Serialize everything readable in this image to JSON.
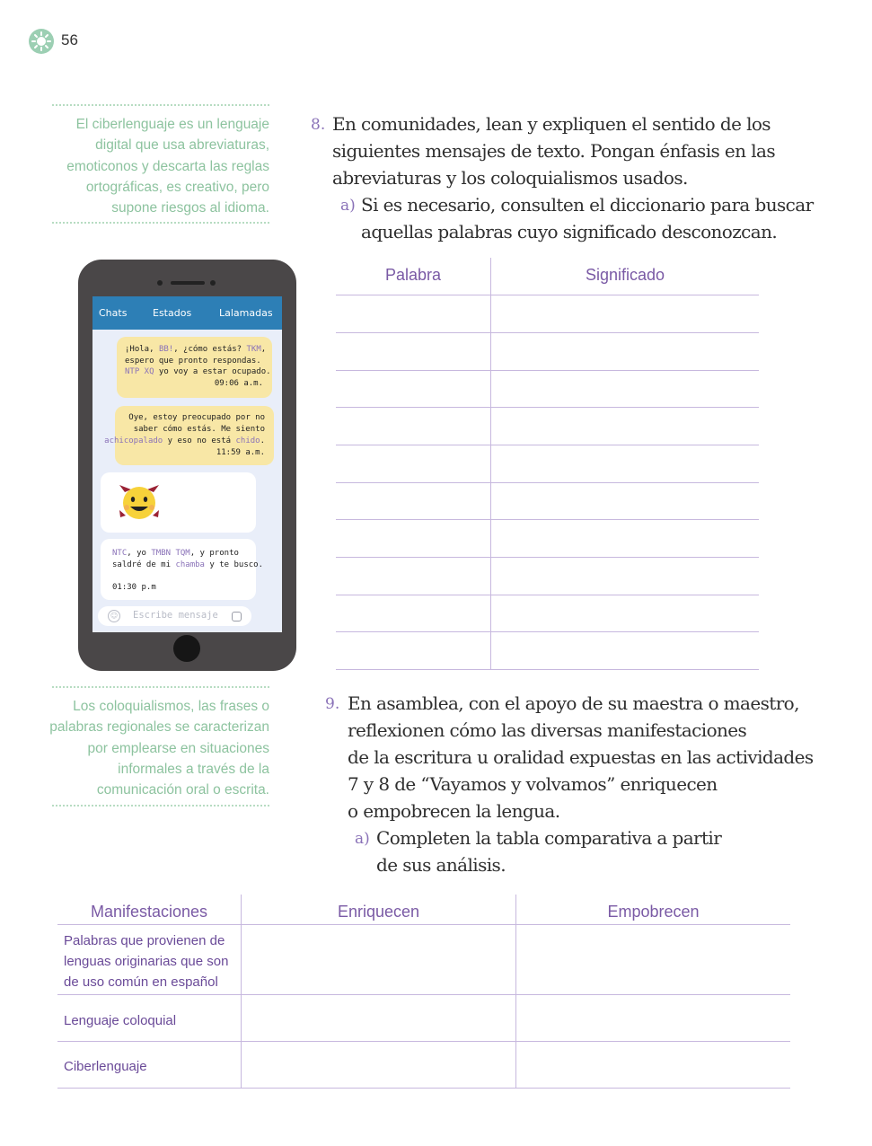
{
  "header": {
    "page_number": "56"
  },
  "notes": {
    "ciberlenguaje": [
      "El ciberlenguaje es un lenguaje",
      "digital que usa abreviaturas,",
      "emoticonos y descarta las reglas",
      "ortográficas, es creativo, pero",
      "supone riesgos al idioma."
    ],
    "coloquialismos": [
      "Los coloquialismos, las frases o",
      "palabras regionales se caracterizan",
      "por emplearse en situaciones",
      "informales a través de la",
      "comunicación oral o escrita."
    ]
  },
  "phone": {
    "tabs": [
      "Chats",
      "Estados",
      "Lalamadas"
    ],
    "msg1": {
      "l1_a": "¡Hola, ",
      "l1_b": "BB!",
      "l1_c": ", ¿cómo estás? ",
      "l1_d": "TKM",
      "l1_e": ",",
      "l2": "espero que pronto respondas.",
      "l3_a": "NTP XQ",
      "l3_b": " yo voy a estar ocupado.",
      "time": "09:06 a.m."
    },
    "msg2": {
      "l1": "Oye, estoy preocupado por no",
      "l2": "saber cómo estás. Me siento",
      "l3_a": "achicopalado",
      "l3_b": " y eso no está ",
      "l3_c": "chido",
      "l3_d": ".",
      "time": "11:59 a.m."
    },
    "msg3": {
      "l1_a": "NTC",
      "l1_b": ", yo ",
      "l1_c": "TMBN TQM",
      "l1_d": ", y pronto",
      "l2_a": "saldré de mi ",
      "l2_b": "chamba",
      "l2_c": " y te busco.",
      "time": "01:30 p.m"
    },
    "input_placeholder": "Escribe mensaje"
  },
  "activity8": {
    "number": "8.",
    "lines": [
      "En comunidades, lean y expliquen el sentido de los",
      "siguientes mensajes de texto. Pongan énfasis en las",
      "abreviaturas y los coloquialismos usados."
    ],
    "sub_letter": "a)",
    "sub_lines": [
      "Si es necesario, consulten el diccionario para buscar",
      "aquellas palabras cuyo significado desconozcan."
    ],
    "table_headers": [
      "Palabra",
      "Significado"
    ]
  },
  "activity9": {
    "number": "9.",
    "lines": [
      "En asamblea, con el apoyo de su maestra o maestro,",
      "reflexionen cómo las diversas manifestaciones",
      "de la escritura u oralidad expuestas en las actividades",
      "7 y 8 de “Vayamos y volvamos” enriquecen",
      "o empobrecen la lengua."
    ],
    "sub_letter": "a)",
    "sub_lines": [
      "Completen la tabla comparativa a partir",
      "de sus análisis."
    ]
  },
  "comparison_table": {
    "headers": [
      "Manifestaciones",
      "Enriquecen",
      "Empobrecen"
    ],
    "rows": [
      [
        "Palabras que provienen de",
        "lenguas originarias que son",
        "de uso común en español"
      ],
      [
        "Lenguaje coloquial"
      ],
      [
        "Ciberlenguaje"
      ]
    ]
  }
}
